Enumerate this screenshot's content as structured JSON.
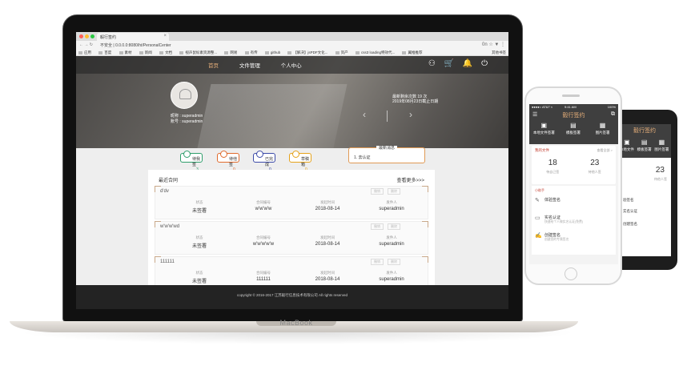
{
  "browser": {
    "tab_title": "毅行签约",
    "address": "不安全 | 0.0.0.0:8080/ht/PersonalCenter",
    "nav_glyphs": "← → ↻",
    "addr_right": "0n ☆ ▼ ⋮",
    "bookmarks": [
      "应用",
      "百度",
      "素材",
      "新闻",
      "文档",
      "视声鼠标素资源整...",
      "网易",
      "有传",
      "github",
      "【解决】jsPDF文化...",
      "资产",
      "css3 loading特效代...",
      "翼推推荐"
    ],
    "bookmarks_right": "其他书签"
  },
  "site": {
    "nav": [
      "首页",
      "文件管理",
      "个人中心"
    ],
    "nav_icons": "⚇ 🛒 🔔 ⏻",
    "user_name_line": "昵称 : superadmin",
    "user_account_line": "账号 : superadmin",
    "msg_count_line1": "最新剩余次数 19 次",
    "msg_count_line2": "2019年08月23日截止日期",
    "slider_left": "‹",
    "slider_right": "›",
    "stats": [
      {
        "label": "待我签",
        "value": "3",
        "color": "#2e9e6b"
      },
      {
        "label": "待他签",
        "value": "0",
        "color": "#e06a2c"
      },
      {
        "label": "已完成",
        "value": "0",
        "color": "#3b4aa8"
      },
      {
        "label": "草稿箱",
        "value": "0",
        "color": "#e5a21a"
      }
    ],
    "news_title": "最新消息",
    "news_item": "1.  去认证",
    "contracts_title": "最近合同",
    "contracts_more": "查看更多>>>",
    "column_headers": [
      "状态",
      "合同编号",
      "发起时间",
      "发件人"
    ],
    "card_buttons": [
      "撤销",
      "删除"
    ],
    "cards": [
      {
        "name": "d'dv",
        "status": "未签署",
        "number": "w'w'w'w",
        "date": "2018-08-14",
        "sender": "superadmin"
      },
      {
        "name": "w'w'w'wd",
        "status": "未签署",
        "number": "w'w'w'w'w",
        "date": "2018-08-14",
        "sender": "superadmin"
      },
      {
        "name": "111111",
        "status": "未签署",
        "number": "111111",
        "date": "2018-08-14",
        "sender": "superadmin"
      }
    ],
    "footer": "copyright © 2016-2017 江苏毅行信息技术有限公司 All rights reserved"
  },
  "laptop_brand": "MacBook",
  "phone_white": {
    "status_left": "●●●●○ AT&T ≈",
    "status_center": "9:41 AM",
    "status_right": "100%",
    "app_title": "毅行签约",
    "menu_icon": "☰",
    "scan_icon": "⧉",
    "tiles": [
      "本地文件签署",
      "模板签署",
      "图片签署"
    ],
    "files_title": "我的文件",
    "files_more": "查看全部 >",
    "files_counts": [
      {
        "n": "18",
        "label": "待自己签"
      },
      {
        "n": "23",
        "label": "待他人签"
      }
    ],
    "section": "小助手",
    "rows": [
      {
        "title": "体验签名",
        "sub": ""
      },
      {
        "title": "实名认证",
        "sub": "快速给个人做实名认证(免费)"
      },
      {
        "title": "创建签名",
        "sub": "创建您的专属签名"
      }
    ]
  },
  "phone_black": {
    "app_title": "毅行签约",
    "tiles": [
      "本地文件",
      "模板签署",
      "图片签署"
    ],
    "counts": [
      {
        "n": "23",
        "label": "待他人签"
      }
    ],
    "rows": [
      "验签名",
      "实名认证",
      "创建签名"
    ]
  }
}
